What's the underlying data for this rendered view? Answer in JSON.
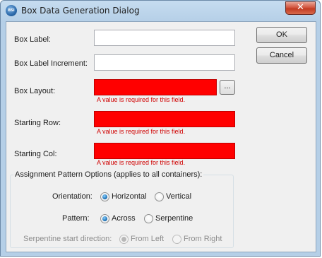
{
  "dialog": {
    "title": "Box Data Generation Dialog",
    "app_icon_text": "BSI",
    "close_glyph": "✕"
  },
  "buttons": {
    "ok": "OK",
    "cancel": "Cancel",
    "browse": "..."
  },
  "fields": {
    "box_label": {
      "label": "Box Label:",
      "value": ""
    },
    "box_label_increment": {
      "label": "Box Label Increment:",
      "value": ""
    },
    "box_layout": {
      "label": "Box Layout:",
      "value": "",
      "error": "A value is required for this field."
    },
    "starting_row": {
      "label": "Starting Row:",
      "value": "",
      "error": "A value is required for this field."
    },
    "starting_col": {
      "label": "Starting Col:",
      "value": "",
      "error": "A value is required for this field."
    }
  },
  "assignment": {
    "group_title": "Assignment Pattern Options (applies to all containers):",
    "orientation": {
      "label": "Orientation:",
      "options": [
        "Horizontal",
        "Vertical"
      ],
      "selected": "Horizontal"
    },
    "pattern": {
      "label": "Pattern:",
      "options": [
        "Across",
        "Serpentine"
      ],
      "selected": "Across"
    },
    "serpentine": {
      "label": "Serpentine start direction:",
      "options": [
        "From Left",
        "From Right"
      ],
      "selected": "From Left",
      "enabled": false
    }
  },
  "colors": {
    "error_fill": "#ff0000",
    "error_text": "#d00000",
    "radio_selected": "#1f73b8",
    "window_frame": "#b5cfe7"
  }
}
